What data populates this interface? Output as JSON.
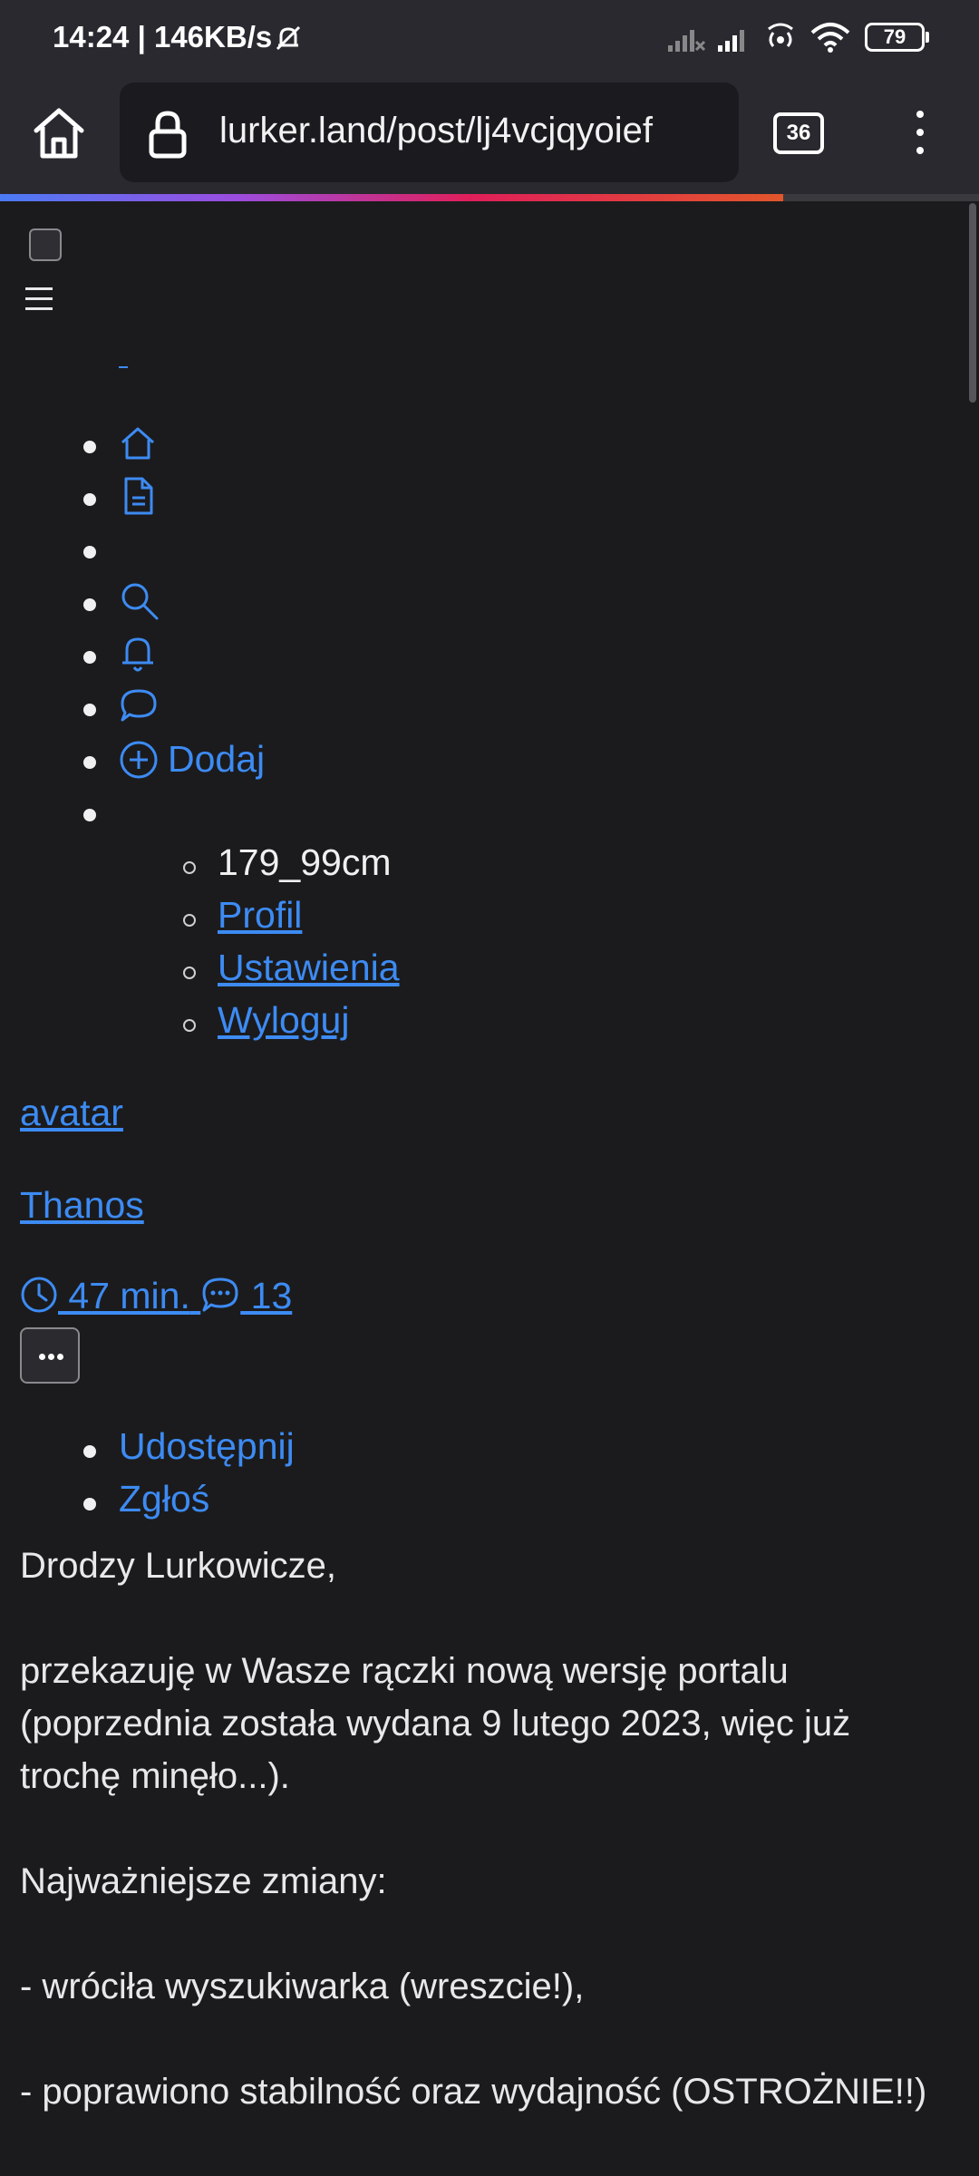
{
  "status_bar": {
    "time_speed": "14:24 | 146KB/s",
    "battery": "79"
  },
  "browser": {
    "url": "lurker.land/post/lj4vcjqyoief",
    "tab_count": "36",
    "load_progress": 0.8
  },
  "nav": {
    "add_label": "Dodaj",
    "submenu": {
      "username": "179_99cm",
      "profile": "Profil",
      "settings": "Ustawienia",
      "logout": "Wyloguj"
    }
  },
  "post": {
    "avatar_text": "avatar",
    "author": "Thanos",
    "time_ago": " 47 min.",
    "comment_count": " 13",
    "actions": {
      "share": "Udostępnij",
      "report": "Zgłoś"
    },
    "body": {
      "greeting": "Drodzy Lurkowicze,",
      "p1": "przekazuję w Wasze rączki nową wersję portalu (poprzednia została wydana 9 lutego 2023, więc już trochę minęło...).",
      "p2": "Najważniejsze zmiany:",
      "p3": "- wróciła wyszukiwarka (wreszcie!),",
      "p4": "- poprawiono stabilność oraz wydajność (OSTROŻNIE!!)"
    }
  },
  "colors": {
    "background": "#1b1b1d",
    "browser_bar": "#2a2930",
    "link": "#3d8bf3",
    "text": "#e8e8ea"
  }
}
